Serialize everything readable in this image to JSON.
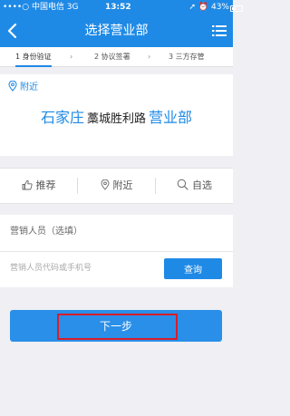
{
  "status_bar": {
    "carrier": "••••○ 中国电信  3G",
    "time": "13:52",
    "right": "43%",
    "battery_level": 0.43
  },
  "header": {
    "title": "选择营业部",
    "back_icon": "chevron-left-icon",
    "menu_icon": "list-menu-icon"
  },
  "steps": [
    {
      "label": "1 身份验证",
      "active": true
    },
    {
      "label": "2 协议签署",
      "active": false
    },
    {
      "label": "3 三方存管",
      "active": false
    }
  ],
  "nearby": {
    "label": "附近",
    "icon": "location-pin-icon",
    "branch": {
      "city": "石家庄",
      "street": "藁城胜利路",
      "suffix": "营业部"
    }
  },
  "tabs": [
    {
      "label": "推荐",
      "icon": "thumbs-up-icon"
    },
    {
      "label": "附近",
      "icon": "location-pin-icon"
    },
    {
      "label": "自选",
      "icon": "search-icon"
    }
  ],
  "form": {
    "label": "营销人员（选填）",
    "input_value": "",
    "input_placeholder": "营销人员代码或手机号",
    "query_label": "查询"
  },
  "next_button": {
    "label": "下一步"
  },
  "colors": {
    "accent": "#1f8ae6",
    "highlight": "#d81e2b",
    "background": "#efeff4"
  }
}
